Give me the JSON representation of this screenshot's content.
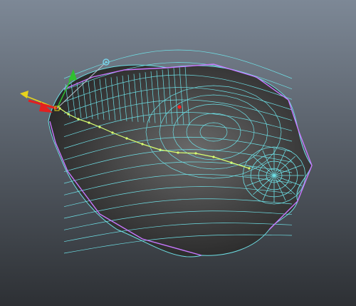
{
  "viewport": {
    "background_top": "#7d8896",
    "background_bottom": "#2d3034",
    "mesh_fill": "#3c3c3c",
    "wire_color": "#6ee0e6",
    "edge_select_color": "#c878ff",
    "vertex_color": "#d8ff70",
    "selected_vertex_color": "#ff2020"
  },
  "manipulator": {
    "x_axis_color": "#e22020",
    "y_axis_color": "#30c030",
    "z_axis_color": "#e8d41c",
    "rotate_handle_color": "#78d2e8",
    "x_axis_icon": "move-x-arrow-icon",
    "y_axis_icon": "move-y-arrow-icon",
    "z_axis_icon": "move-z-arrow-icon",
    "handle_icon": "rotate-handle-icon"
  }
}
